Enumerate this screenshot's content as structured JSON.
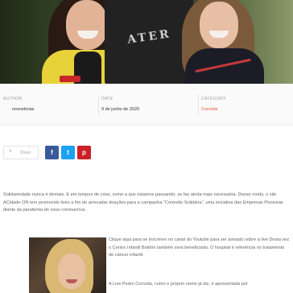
{
  "meta": {
    "author_label": "AUTHOR",
    "author_value": "nosnoticias",
    "date_label": "DATE",
    "date_value": "9 de junho de 2020",
    "category_label": "CATEGORY",
    "category_value": "Convida"
  },
  "share": {
    "label": "Share",
    "buttons": [
      "f",
      "t",
      "p"
    ]
  },
  "hero": {
    "shirt_text": "ATER"
  },
  "article": {
    "paragraph1": "Solidariedade nunca é demais. E em tempos de crise, como a que estamos passando, se faz ainda mais necessária. Desse modo, o site ACidade ON tem promovido lives a fim de arrecadar doações para a campanha “Conexão Solidária”, uma iniciativa das Empresas Pioneiras diante da pandemia do novo coronavírus.",
    "paragraph2": "Clique aqui para se inscrever no canal do Youtube para ser avisado sobre a live Desta vez o Centro Infantil Boldrin também será beneficiado. O hospital é referência no tratamento de câncer infantil.",
    "paragraph3": "A Live Pedro Convida, como o próprio nome já diz, é apresentada por"
  },
  "colors": {
    "category": "#e5553b",
    "facebook": "#3b5998",
    "twitter": "#1da1f2",
    "pinterest": "#cb2027"
  },
  "icons": [
    "share-icon",
    "facebook-icon",
    "twitter-icon",
    "pinterest-icon"
  ]
}
